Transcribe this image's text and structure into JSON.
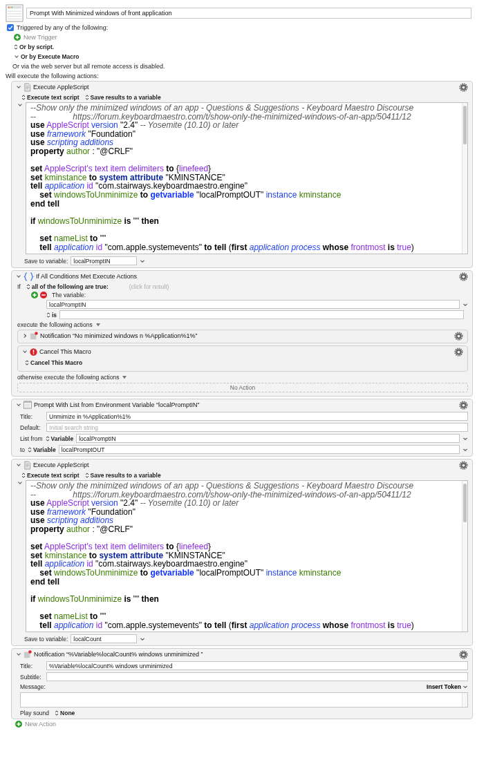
{
  "macro": {
    "name": "Prompt With Minimized windows of front application"
  },
  "triggers": {
    "label": "Triggered by any of the following:",
    "checked": true,
    "new_trigger": "New Trigger",
    "options": [
      {
        "kind": "popup",
        "label": "Or by script."
      },
      {
        "kind": "disclosure",
        "label": "Or by Execute Macro"
      }
    ],
    "web_note": "Or via the web server but all remote access is disabled."
  },
  "actions_heading": "Will execute the following actions:",
  "actions": [
    {
      "kind": "applescript",
      "title": "Execute AppleScript",
      "expanded": true,
      "source_popup": "Execute text script",
      "result_popup": "Save results to a variable",
      "save_label": "Save to variable:",
      "save_variable": "localPromptIN",
      "script": [
        {
          "kind": "code",
          "tokens": [
            {
              "kind": "comment",
              "text": "--Show only the minimized windows of an app - Questions & Suggestions - Keyboard Maestro Discourse"
            }
          ]
        },
        {
          "kind": "code",
          "tokens": [
            {
              "kind": "comment",
              "text": "--                https://forum.keyboardmaestro.com/t/show-only-the-minimized-windows-of-an-app/50411/12"
            }
          ]
        },
        {
          "kind": "code",
          "tokens": [
            {
              "kind": "keyword",
              "text": "use"
            },
            {
              "kind": "class",
              "text": " AppleScript"
            },
            {
              "kind": "property",
              "text": " version"
            },
            {
              "kind": "string",
              "text": " \"2.4\""
            },
            {
              "kind": "comment",
              "text": " -- Yosemite (10.10) or later"
            }
          ]
        },
        {
          "kind": "code",
          "tokens": [
            {
              "kind": "keyword",
              "text": "use"
            },
            {
              "kind": "term",
              "text": " framework"
            },
            {
              "kind": "string",
              "text": " \"Foundation\""
            }
          ]
        },
        {
          "kind": "code",
          "tokens": [
            {
              "kind": "keyword",
              "text": "use"
            },
            {
              "kind": "term",
              "text": " scripting additions"
            }
          ]
        },
        {
          "kind": "code",
          "tokens": [
            {
              "kind": "keyword",
              "text": "property"
            },
            {
              "kind": "variable",
              "text": " author"
            },
            {
              "kind": "string",
              "text": " : \"@CRLF\""
            }
          ]
        },
        {
          "kind": "blank"
        },
        {
          "kind": "code",
          "tokens": [
            {
              "kind": "keyword",
              "text": "set"
            },
            {
              "kind": "class",
              "text": " AppleScript's text item delimiters"
            },
            {
              "kind": "keyword",
              "text": " to"
            },
            {
              "kind": "string",
              "text": " {"
            },
            {
              "kind": "class",
              "text": "linefeed"
            },
            {
              "kind": "string",
              "text": "}"
            }
          ]
        },
        {
          "kind": "code",
          "tokens": [
            {
              "kind": "keyword",
              "text": "set"
            },
            {
              "kind": "variable",
              "text": " kminstance"
            },
            {
              "kind": "keyword",
              "text": " to"
            },
            {
              "kind": "command",
              "text": " system attribute"
            },
            {
              "kind": "string",
              "text": " \"KMINSTANCE\""
            }
          ]
        },
        {
          "kind": "code",
          "tokens": [
            {
              "kind": "keyword",
              "text": "tell"
            },
            {
              "kind": "term",
              "text": " application"
            },
            {
              "kind": "class",
              "text": " id"
            },
            {
              "kind": "string",
              "text": " \"com.stairways.keyboardmaestro.engine\""
            }
          ]
        },
        {
          "kind": "code",
          "tokens": [
            {
              "kind": "keyword",
              "text": "    set"
            },
            {
              "kind": "variable",
              "text": " windowsToUnminimize"
            },
            {
              "kind": "keyword",
              "text": " to"
            },
            {
              "kind": "handler",
              "text": " getvariable"
            },
            {
              "kind": "string",
              "text": " \"localPromptOUT\""
            },
            {
              "kind": "property",
              "text": " instance"
            },
            {
              "kind": "variable",
              "text": " kminstance"
            }
          ]
        },
        {
          "kind": "code",
          "tokens": [
            {
              "kind": "keyword",
              "text": "end tell"
            }
          ]
        },
        {
          "kind": "blank"
        },
        {
          "kind": "code",
          "tokens": [
            {
              "kind": "keyword",
              "text": "if"
            },
            {
              "kind": "variable",
              "text": " windowsToUnminimize"
            },
            {
              "kind": "keyword",
              "text": " is"
            },
            {
              "kind": "string",
              "text": " \"\""
            },
            {
              "kind": "keyword",
              "text": " then"
            }
          ]
        },
        {
          "kind": "blank"
        },
        {
          "kind": "code",
          "tokens": [
            {
              "kind": "keyword",
              "text": "    set"
            },
            {
              "kind": "variable",
              "text": " nameList"
            },
            {
              "kind": "keyword",
              "text": " to"
            },
            {
              "kind": "string",
              "text": " \"\""
            }
          ]
        },
        {
          "kind": "code",
          "tokens": [
            {
              "kind": "keyword",
              "text": "    tell"
            },
            {
              "kind": "term",
              "text": " application"
            },
            {
              "kind": "class",
              "text": " id"
            },
            {
              "kind": "string",
              "text": " \"com.apple.systemevents\""
            },
            {
              "kind": "keyword",
              "text": " to tell"
            },
            {
              "kind": "string",
              "text": " ("
            },
            {
              "kind": "keyword",
              "text": "first"
            },
            {
              "kind": "term",
              "text": " application process"
            },
            {
              "kind": "keyword",
              "text": " whose"
            },
            {
              "kind": "class",
              "text": " frontmost"
            },
            {
              "kind": "keyword",
              "text": " is"
            },
            {
              "kind": "class",
              "text": " true"
            },
            {
              "kind": "string",
              "text": ")"
            }
          ]
        }
      ]
    },
    {
      "kind": "if",
      "title": "If All Conditions Met Execute Actions",
      "expanded": true,
      "if_label": "If",
      "match_popup": "all of the following are true:",
      "result_hint": "(click for result)",
      "condition": {
        "label": "The variable:",
        "variable": "localPromptIN",
        "operator": "is"
      },
      "then_label": "execute the following actions",
      "then_actions": [
        {
          "kind": "notification",
          "title": "Notification “No minimized windows n %Application%1%”",
          "expanded": false
        },
        {
          "kind": "cancel",
          "title": "Cancel This Macro",
          "expanded": true,
          "popup": "Cancel This Macro"
        }
      ],
      "else_label": "otherwise execute the following actions",
      "else_empty": "No Action"
    },
    {
      "kind": "prompt",
      "title": "Prompt With List from Environment Variable “localPromptIN”",
      "expanded": true,
      "title_label": "Title:",
      "title_value": "Unmimize in %Application%1%",
      "default_label": "Default:",
      "default_placeholder": "Initial search string",
      "list_label": "List from",
      "list_popup": "Variable",
      "list_value": "localPromptIN",
      "to_label": "to",
      "to_popup": "Variable",
      "to_value": "localPromptOUT"
    },
    {
      "kind": "applescript",
      "title": "Execute AppleScript",
      "expanded": true,
      "source_popup": "Execute text script",
      "result_popup": "Save results to a variable",
      "save_label": "Save to variable:",
      "save_variable": "localCount",
      "script": [
        {
          "kind": "code",
          "tokens": [
            {
              "kind": "comment",
              "text": "--Show only the minimized windows of an app - Questions & Suggestions - Keyboard Maestro Discourse"
            }
          ]
        },
        {
          "kind": "code",
          "tokens": [
            {
              "kind": "comment",
              "text": "--                https://forum.keyboardmaestro.com/t/show-only-the-minimized-windows-of-an-app/50411/12"
            }
          ]
        },
        {
          "kind": "code",
          "tokens": [
            {
              "kind": "keyword",
              "text": "use"
            },
            {
              "kind": "class",
              "text": " AppleScript"
            },
            {
              "kind": "property",
              "text": " version"
            },
            {
              "kind": "string",
              "text": " \"2.4\""
            },
            {
              "kind": "comment",
              "text": " -- Yosemite (10.10) or later"
            }
          ]
        },
        {
          "kind": "code",
          "tokens": [
            {
              "kind": "keyword",
              "text": "use"
            },
            {
              "kind": "term",
              "text": " framework"
            },
            {
              "kind": "string",
              "text": " \"Foundation\""
            }
          ]
        },
        {
          "kind": "code",
          "tokens": [
            {
              "kind": "keyword",
              "text": "use"
            },
            {
              "kind": "term",
              "text": " scripting additions"
            }
          ]
        },
        {
          "kind": "code",
          "tokens": [
            {
              "kind": "keyword",
              "text": "property"
            },
            {
              "kind": "variable",
              "text": " author"
            },
            {
              "kind": "string",
              "text": " : \"@CRLF\""
            }
          ]
        },
        {
          "kind": "blank"
        },
        {
          "kind": "code",
          "tokens": [
            {
              "kind": "keyword",
              "text": "set"
            },
            {
              "kind": "class",
              "text": " AppleScript's text item delimiters"
            },
            {
              "kind": "keyword",
              "text": " to"
            },
            {
              "kind": "string",
              "text": " {"
            },
            {
              "kind": "class",
              "text": "linefeed"
            },
            {
              "kind": "string",
              "text": "}"
            }
          ]
        },
        {
          "kind": "code",
          "tokens": [
            {
              "kind": "keyword",
              "text": "set"
            },
            {
              "kind": "variable",
              "text": " kminstance"
            },
            {
              "kind": "keyword",
              "text": " to"
            },
            {
              "kind": "command",
              "text": " system attribute"
            },
            {
              "kind": "string",
              "text": " \"KMINSTANCE\""
            }
          ]
        },
        {
          "kind": "code",
          "tokens": [
            {
              "kind": "keyword",
              "text": "tell"
            },
            {
              "kind": "term",
              "text": " application"
            },
            {
              "kind": "class",
              "text": " id"
            },
            {
              "kind": "string",
              "text": " \"com.stairways.keyboardmaestro.engine\""
            }
          ]
        },
        {
          "kind": "code",
          "tokens": [
            {
              "kind": "keyword",
              "text": "    set"
            },
            {
              "kind": "variable",
              "text": " windowsToUnminimize"
            },
            {
              "kind": "keyword",
              "text": " to"
            },
            {
              "kind": "handler",
              "text": " getvariable"
            },
            {
              "kind": "string",
              "text": " \"localPromptOUT\""
            },
            {
              "kind": "property",
              "text": " instance"
            },
            {
              "kind": "variable",
              "text": " kminstance"
            }
          ]
        },
        {
          "kind": "code",
          "tokens": [
            {
              "kind": "keyword",
              "text": "end tell"
            }
          ]
        },
        {
          "kind": "blank"
        },
        {
          "kind": "code",
          "tokens": [
            {
              "kind": "keyword",
              "text": "if"
            },
            {
              "kind": "variable",
              "text": " windowsToUnminimize"
            },
            {
              "kind": "keyword",
              "text": " is"
            },
            {
              "kind": "string",
              "text": " \"\""
            },
            {
              "kind": "keyword",
              "text": " then"
            }
          ]
        },
        {
          "kind": "blank"
        },
        {
          "kind": "code",
          "tokens": [
            {
              "kind": "keyword",
              "text": "    set"
            },
            {
              "kind": "variable",
              "text": " nameList"
            },
            {
              "kind": "keyword",
              "text": " to"
            },
            {
              "kind": "string",
              "text": " \"\""
            }
          ]
        },
        {
          "kind": "code",
          "tokens": [
            {
              "kind": "keyword",
              "text": "    tell"
            },
            {
              "kind": "term",
              "text": " application"
            },
            {
              "kind": "class",
              "text": " id"
            },
            {
              "kind": "string",
              "text": " \"com.apple.systemevents\""
            },
            {
              "kind": "keyword",
              "text": " to tell"
            },
            {
              "kind": "string",
              "text": " ("
            },
            {
              "kind": "keyword",
              "text": "first"
            },
            {
              "kind": "term",
              "text": " application process"
            },
            {
              "kind": "keyword",
              "text": " whose"
            },
            {
              "kind": "class",
              "text": " frontmost"
            },
            {
              "kind": "keyword",
              "text": " is"
            },
            {
              "kind": "class",
              "text": " true"
            },
            {
              "kind": "string",
              "text": ")"
            }
          ]
        }
      ]
    },
    {
      "kind": "notification",
      "title": "Notification “%Variable%localCount% windows unminimized ”",
      "expanded": true,
      "title_label": "Title:",
      "title_value": "%Variable%localCount% windows unminimized",
      "subtitle_label": "Subtitle:",
      "message_label": "Message:",
      "insert_token": "Insert Token",
      "sound_label": "Play sound",
      "sound_popup": "None"
    }
  ],
  "new_action": "New Action"
}
